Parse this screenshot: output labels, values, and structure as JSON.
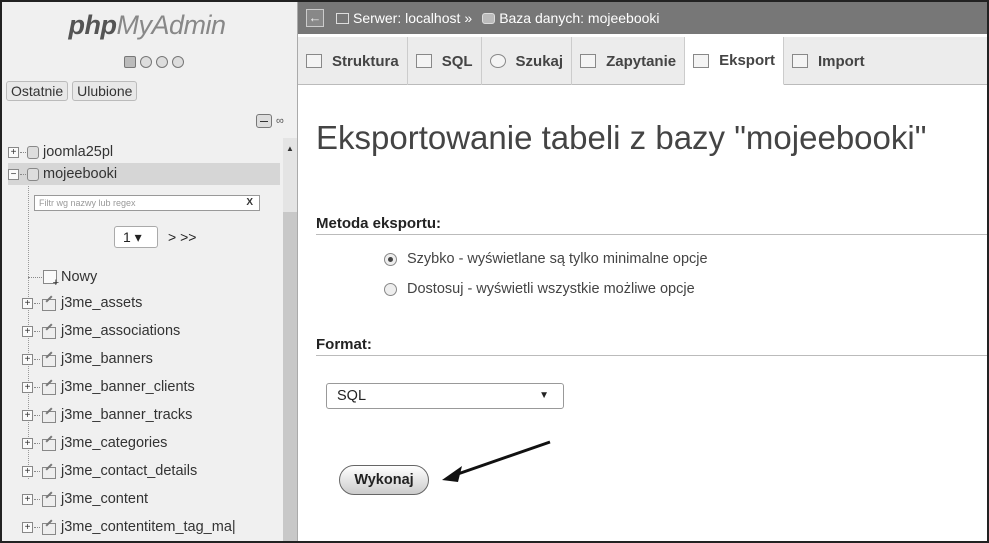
{
  "logo": {
    "php": "php",
    "myadmin": "MyAdmin"
  },
  "recent_tabs": [
    "Ostatnie",
    "Ulubione"
  ],
  "tree": {
    "databases": [
      "joomla25pl",
      "mojeebooki"
    ],
    "filter_placeholder": "Filtr wg nazwy lub regex",
    "filter_clear": "X",
    "page_select": "1",
    "page_nav": "> >>",
    "new_label": "Nowy",
    "tables": [
      "j3me_assets",
      "j3me_associations",
      "j3me_banners",
      "j3me_banner_clients",
      "j3me_banner_tracks",
      "j3me_categories",
      "j3me_contact_details",
      "j3me_content",
      "j3me_contentitem_tag_ma|"
    ]
  },
  "breadcrumb": {
    "server": "Serwer: localhost",
    "separator": "»",
    "database": "Baza danych: mojeebooki"
  },
  "tabs": [
    "Struktura",
    "SQL",
    "Szukaj",
    "Zapytanie",
    "Eksport",
    "Import"
  ],
  "active_tab": "Eksport",
  "main": {
    "title": "Eksportowanie tabeli z bazy \"mojeebooki\"",
    "method_label": "Metoda eksportu:",
    "method_options": [
      "Szybko - wyświetlane są tylko minimalne opcje",
      "Dostosuj - wyświetli wszystkie możliwe opcje"
    ],
    "format_label": "Format:",
    "format_value": "SQL",
    "go_button": "Wykonaj"
  }
}
